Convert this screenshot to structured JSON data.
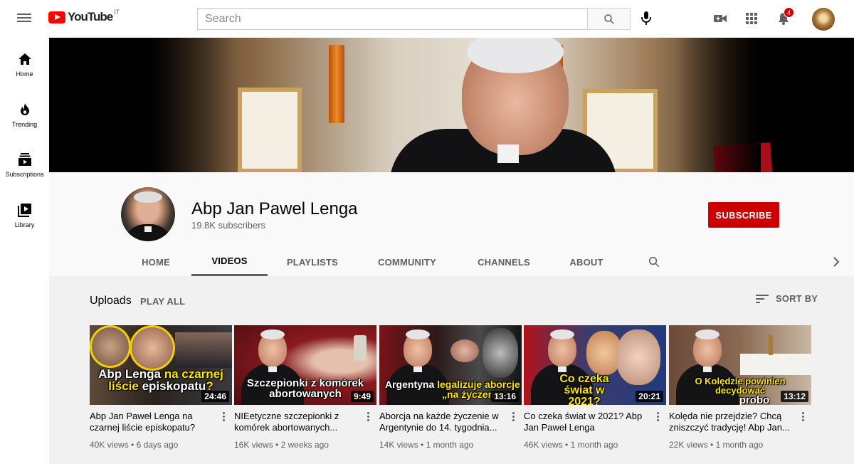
{
  "masthead": {
    "logo_text": "YouTube",
    "country_code": "IT",
    "search_placeholder": "Search",
    "notification_count": "4"
  },
  "guide": {
    "items": [
      {
        "label": "Home",
        "icon": "home-icon"
      },
      {
        "label": "Trending",
        "icon": "trending-icon"
      },
      {
        "label": "Subscriptions",
        "icon": "subscriptions-icon"
      },
      {
        "label": "Library",
        "icon": "library-icon"
      }
    ]
  },
  "channel": {
    "name": "Abp Jan Pawel Lenga",
    "subscribers": "19.8K subscribers",
    "subscribe_label": "SUBSCRIBE",
    "tabs": [
      "HOME",
      "VIDEOS",
      "PLAYLISTS",
      "COMMUNITY",
      "CHANNELS",
      "ABOUT"
    ],
    "active_tab": "VIDEOS"
  },
  "uploads": {
    "title": "Uploads",
    "play_all": "PLAY ALL",
    "sort_by": "SORT BY",
    "videos": [
      {
        "title": "Abp Jan Paweł Lenga na czarnej liście episkopatu?",
        "views": "40K views",
        "age": "6 days ago",
        "duration": "24:46",
        "caption_parts": [
          "Abp Lenga ",
          "na czarnej",
          "liście ",
          "episkopatu",
          "?"
        ]
      },
      {
        "title": "NIEetyczne szczepionki z komórek abortowanych...",
        "views": "16K views",
        "age": "2 weeks ago",
        "duration": "9:49",
        "caption_parts": [
          "Szczepionki z ",
          "komórek",
          "abortowanych"
        ]
      },
      {
        "title": "Aborcja na każde życzenie w Argentynie do 14. tygodnia...",
        "views": "14K views",
        "age": "1 month ago",
        "duration": "13:16",
        "caption_parts": [
          "Argentyna ",
          "legalizuje aborcje",
          "„na życzenie”"
        ]
      },
      {
        "title": "Co czeka świat w 2021? Abp Jan Paweł Lenga",
        "views": "46K views",
        "age": "1 month ago",
        "duration": "20:21",
        "caption_parts": [
          "Co czeka",
          "świat w 2021?"
        ]
      },
      {
        "title": "Kolęda nie przejdzie? Chcą zniszczyć tradycję! Abp Jan...",
        "views": "22K views",
        "age": "1 month ago",
        "duration": "13:12",
        "caption_parts": [
          "O Kolędzie powinien decydować",
          "probo"
        ]
      }
    ]
  },
  "colors": {
    "brand_red": "#ff0000",
    "subscribe_red": "#cc0000",
    "caption_yellow": "#ffe600"
  }
}
